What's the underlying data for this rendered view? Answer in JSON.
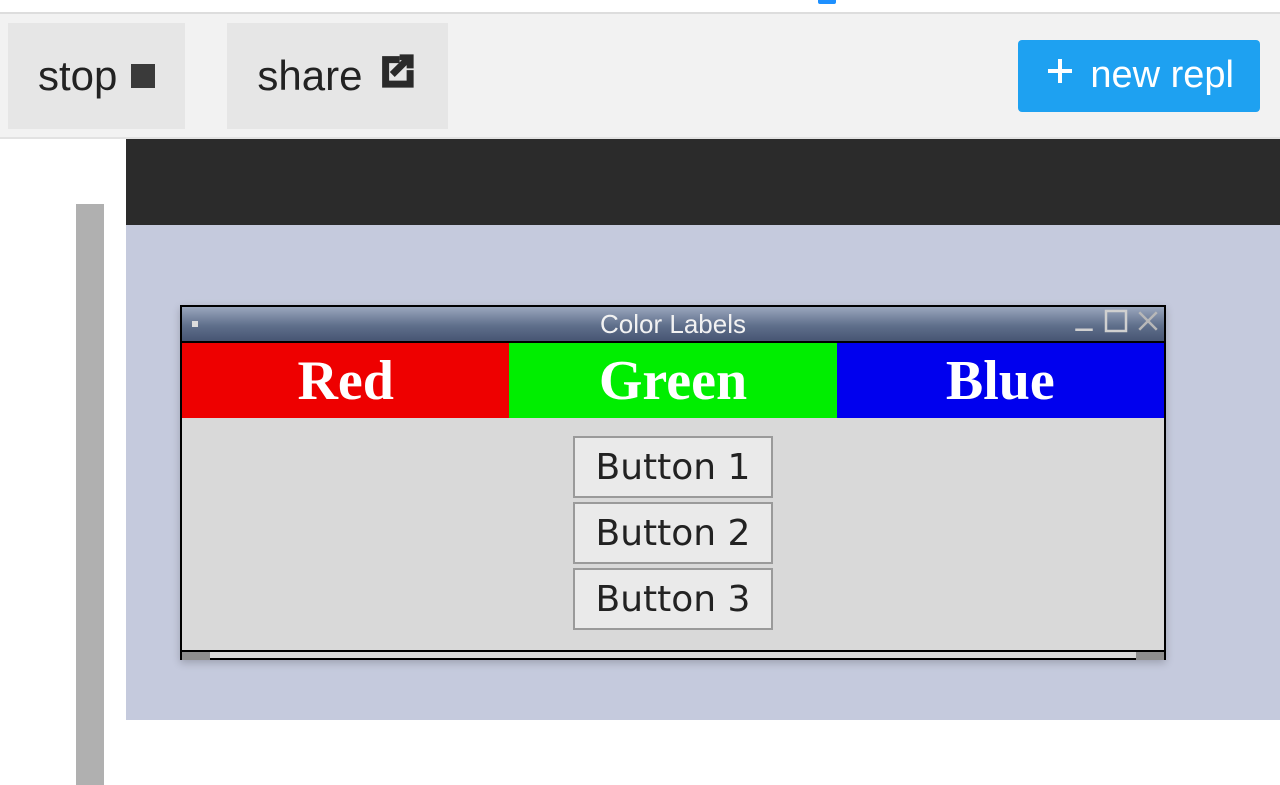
{
  "toolbar": {
    "stop_label": "stop",
    "share_label": "share",
    "new_repl_label": "new repl"
  },
  "tk_window": {
    "title": "Color Labels",
    "labels": [
      {
        "text": "Red",
        "color": "#ee0000"
      },
      {
        "text": "Green",
        "color": "#00ee00"
      },
      {
        "text": "Blue",
        "color": "#0000ee"
      }
    ],
    "buttons": [
      "Button 1",
      "Button 2",
      "Button 3"
    ]
  },
  "icons": {
    "stop": "stop-icon",
    "share": "share-icon",
    "plus": "plus-icon",
    "minimize": "minimize-icon",
    "maximize": "maximize-icon",
    "close": "close-icon"
  },
  "colors": {
    "accent": "#1ea1f1",
    "vnc_bg": "#c5cadd",
    "console_bar": "#2b2b2b"
  }
}
